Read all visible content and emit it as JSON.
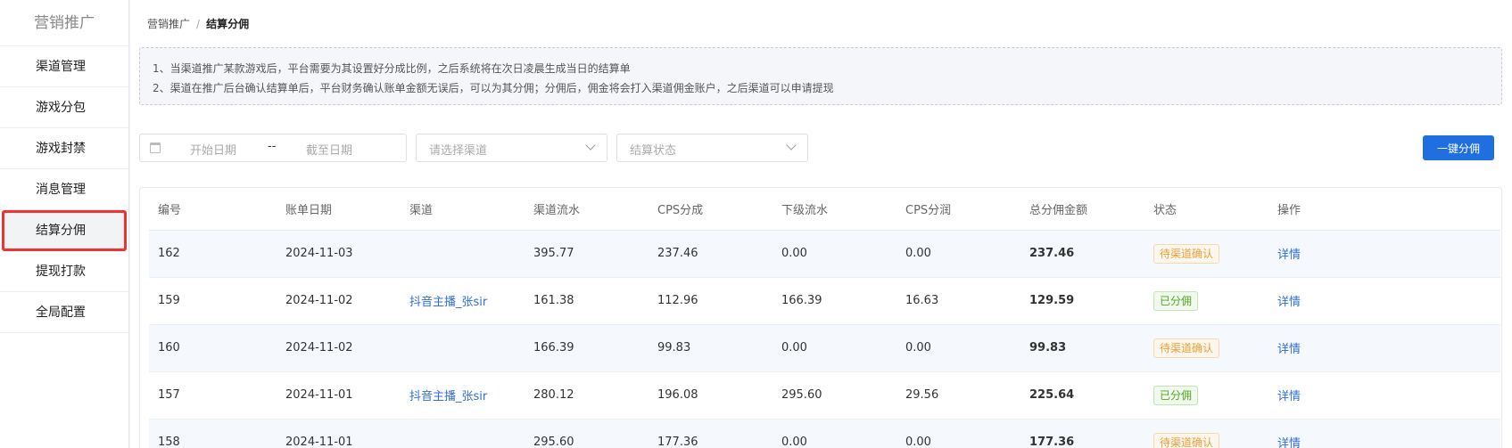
{
  "sidebar": {
    "brand": "营销推广",
    "items": [
      {
        "label": "渠道管理",
        "active": false
      },
      {
        "label": "游戏分包",
        "active": false
      },
      {
        "label": "游戏封禁",
        "active": false
      },
      {
        "label": "消息管理",
        "active": false
      },
      {
        "label": "结算分佣",
        "active": true
      },
      {
        "label": "提现打款",
        "active": false
      },
      {
        "label": "全局配置",
        "active": false
      }
    ]
  },
  "breadcrumb": {
    "parent": "营销推广",
    "separator": "/",
    "current": "结算分佣"
  },
  "notice": {
    "line1": "1、当渠道推广某款游戏后，平台需要为其设置好分成比例，之后系统将在次日凌晨生成当日的结算单",
    "line2": "2、渠道在推广后台确认结算单后，平台财务确认账单金额无误后，可以为其分佣；分佣后，佣金将会打入渠道佣金账户，之后渠道可以申请提现"
  },
  "filters": {
    "start_placeholder": "开始日期",
    "range_separator": "--",
    "end_placeholder": "截至日期",
    "channel_placeholder": "请选择渠道",
    "status_placeholder": "结算状态"
  },
  "actions": {
    "batch_commission": "一键分佣"
  },
  "table": {
    "headers": [
      "编号",
      "账单日期",
      "渠道",
      "渠道流水",
      "CPS分成",
      "下级流水",
      "CPS分润",
      "总分佣金额",
      "状态",
      "操作"
    ],
    "rows": [
      {
        "id": "162",
        "date": "2024-11-03",
        "channel": "",
        "flow": "395.77",
        "cps_share": "237.46",
        "sub_flow": "0.00",
        "cps_profit": "0.00",
        "total": "237.46",
        "status": "待渠道确认",
        "status_type": "pending",
        "op": "详情"
      },
      {
        "id": "159",
        "date": "2024-11-02",
        "channel": "抖音主播_张sir",
        "flow": "161.38",
        "cps_share": "112.96",
        "sub_flow": "166.39",
        "cps_profit": "16.63",
        "total": "129.59",
        "status": "已分佣",
        "status_type": "done",
        "op": "详情"
      },
      {
        "id": "160",
        "date": "2024-11-02",
        "channel": "",
        "flow": "166.39",
        "cps_share": "99.83",
        "sub_flow": "0.00",
        "cps_profit": "0.00",
        "total": "99.83",
        "status": "待渠道确认",
        "status_type": "pending",
        "op": "详情"
      },
      {
        "id": "157",
        "date": "2024-11-01",
        "channel": "抖音主播_张sir",
        "flow": "280.12",
        "cps_share": "196.08",
        "sub_flow": "295.60",
        "cps_profit": "29.56",
        "total": "225.64",
        "status": "已分佣",
        "status_type": "done",
        "op": "详情"
      },
      {
        "id": "158",
        "date": "2024-11-01",
        "channel": "",
        "flow": "295.60",
        "cps_share": "177.36",
        "sub_flow": "0.00",
        "cps_profit": "0.00",
        "total": "177.36",
        "status": "待渠道确认",
        "status_type": "pending",
        "op": "详情"
      }
    ]
  },
  "colors": {
    "primary": "#1f6fe0",
    "link": "#2f6fd6",
    "pending": "#e6a23c",
    "done": "#52a728",
    "highlight": "#e33333"
  }
}
